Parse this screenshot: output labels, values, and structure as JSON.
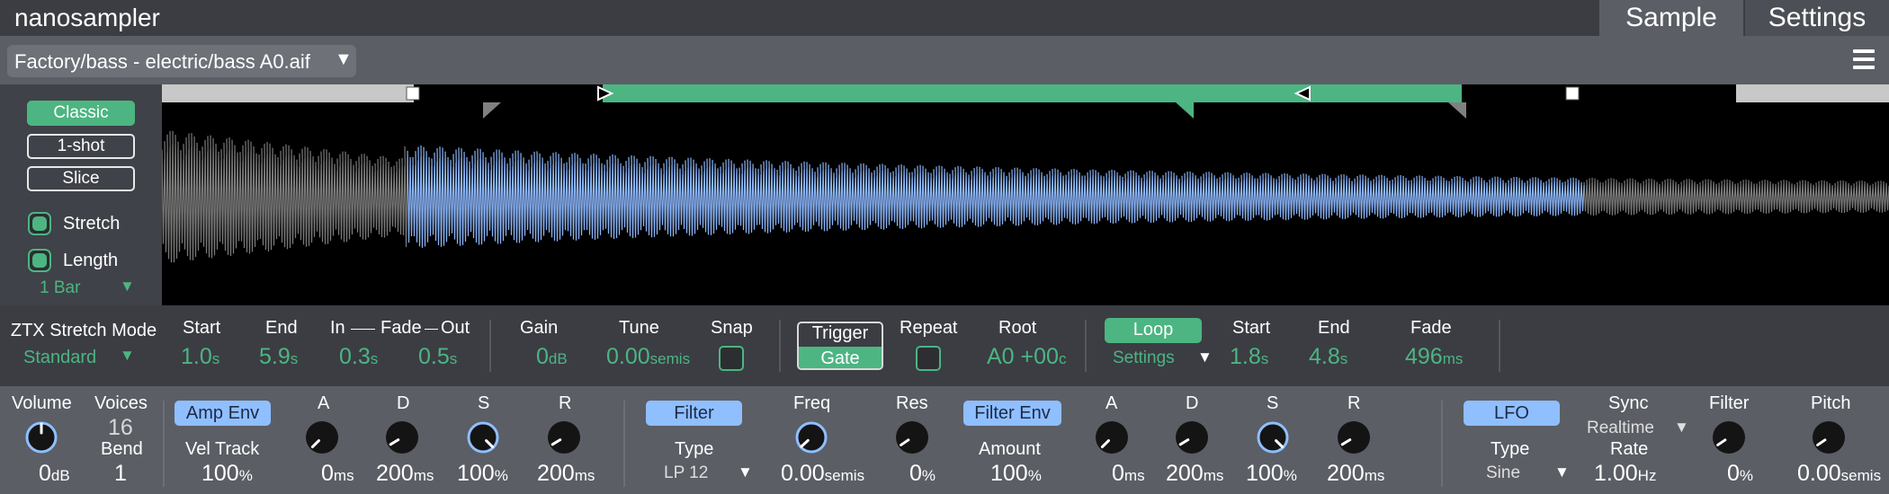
{
  "app": {
    "title": "nanosampler"
  },
  "tabs": [
    {
      "label": "Sample"
    },
    {
      "label": "Settings"
    }
  ],
  "file": {
    "name": "Factory/bass - electric/bass A0.aif"
  },
  "colors": {
    "accent": "#4cb582",
    "waveform": "#8ab4f8",
    "knob_highlight": "#8fbfff"
  },
  "modes": {
    "classic": "Classic",
    "oneshot": "1-shot",
    "slice": "Slice"
  },
  "stretch": {
    "label": "Stretch",
    "checked": true
  },
  "length": {
    "label": "Length",
    "checked": true,
    "value": "1 Bar"
  },
  "ztx": {
    "label": "ZTX Stretch Mode",
    "value": "Standard"
  },
  "sample": {
    "start": {
      "label": "Start",
      "value": "1.0",
      "unit": "s"
    },
    "end": {
      "label": "End",
      "value": "5.9",
      "unit": "s"
    },
    "in_label": "In",
    "fade_label": "Fade",
    "out_label": "Out",
    "fade_in": {
      "value": "0.3",
      "unit": "s"
    },
    "fade_out": {
      "value": "0.5",
      "unit": "s"
    },
    "gain": {
      "label": "Gain",
      "value": "0",
      "unit": "dB"
    },
    "tune": {
      "label": "Tune",
      "value": "0.00",
      "unit": "semis"
    },
    "snap": {
      "label": "Snap"
    },
    "trigger": {
      "label": "Trigger"
    },
    "gate": {
      "label": "Gate"
    },
    "repeat": {
      "label": "Repeat"
    },
    "root": {
      "label": "Root",
      "value": "A0",
      "cents": "+00",
      "unit": "c"
    }
  },
  "loop": {
    "label": "Loop",
    "settings": "Settings",
    "start": {
      "label": "Start",
      "value": "1.8",
      "unit": "s"
    },
    "end": {
      "label": "End",
      "value": "4.8",
      "unit": "s"
    },
    "fade": {
      "label": "Fade",
      "value": "496",
      "unit": "ms"
    }
  },
  "bottom": {
    "volume": {
      "label": "Volume",
      "value": "0",
      "unit": "dB"
    },
    "voices": {
      "label": "Voices",
      "value": "16"
    },
    "bend": {
      "label": "Bend",
      "value": "1"
    },
    "amp_env": {
      "label": "Amp Env",
      "vel_label": "Vel Track",
      "vel_value": "100",
      "vel_unit": "%",
      "a": {
        "label": "A",
        "value": "0",
        "unit": "ms"
      },
      "d": {
        "label": "D",
        "value": "200",
        "unit": "ms"
      },
      "s": {
        "label": "S",
        "value": "100",
        "unit": "%"
      },
      "r": {
        "label": "R",
        "value": "200",
        "unit": "ms"
      }
    },
    "filter": {
      "label": "Filter",
      "type_label": "Type",
      "type_value": "LP 12",
      "freq": {
        "label": "Freq",
        "value": "0.00",
        "unit": "semis"
      },
      "res": {
        "label": "Res",
        "value": "0",
        "unit": "%"
      }
    },
    "filter_env": {
      "label": "Filter Env",
      "amount_label": "Amount",
      "amount_value": "100",
      "amount_unit": "%",
      "a": {
        "label": "A",
        "value": "0",
        "unit": "ms"
      },
      "d": {
        "label": "D",
        "value": "200",
        "unit": "ms"
      },
      "s": {
        "label": "S",
        "value": "100",
        "unit": "%"
      },
      "r": {
        "label": "R",
        "value": "200",
        "unit": "ms"
      }
    },
    "lfo": {
      "label": "LFO",
      "type_label": "Type",
      "type_value": "Sine",
      "sync_label": "Sync",
      "sync_value": "Realtime",
      "rate_label": "Rate",
      "rate_value": "1.00",
      "rate_unit": "Hz",
      "filter": {
        "label": "Filter",
        "value": "0",
        "unit": "%"
      },
      "pitch": {
        "label": "Pitch",
        "value": "0.00",
        "unit": "semis"
      }
    }
  }
}
